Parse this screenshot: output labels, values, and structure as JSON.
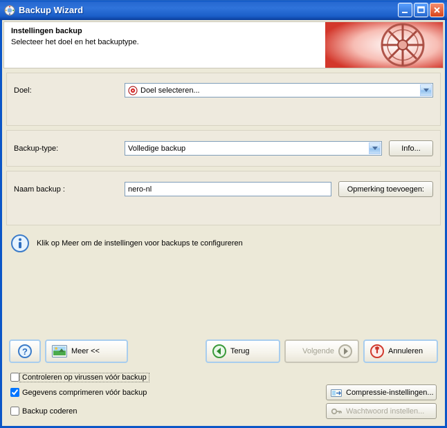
{
  "window": {
    "title": "Backup Wizard"
  },
  "header": {
    "heading": "Instellingen backup",
    "subheading": "Selecteer het doel en het backuptype."
  },
  "fields": {
    "target": {
      "label": "Doel:",
      "value": "Doel selecteren..."
    },
    "backup_type": {
      "label": "Backup-type:",
      "value": "Volledige backup",
      "info_button": "Info..."
    },
    "backup_name": {
      "label": "Naam backup :",
      "value": "nero-nl",
      "comment_button": "Opmerking toevoegen:"
    }
  },
  "hint": {
    "text": "Klik op Meer om de instellingen voor backups te configureren"
  },
  "buttons": {
    "more": "Meer <<",
    "back": "Terug",
    "next": "Volgende",
    "cancel": "Annuleren"
  },
  "options": {
    "virus_check": {
      "label": "Controleren op virussen vóór backup",
      "checked": false
    },
    "compress": {
      "label": "Gegevens comprimeren vóór backup",
      "checked": true
    },
    "encode": {
      "label": "Backup coderen",
      "checked": false
    },
    "compression_button": "Compressie-instellingen...",
    "password_button": "Wachtwoord instellen..."
  }
}
